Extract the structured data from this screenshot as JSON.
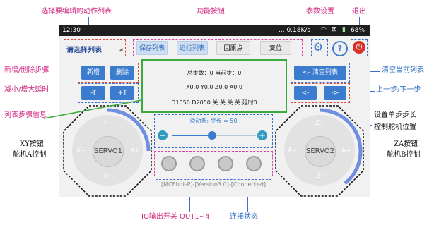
{
  "annotations": {
    "select_list": "选择要编辑的动作列表",
    "function_buttons": "功能按钮",
    "settings": "参数设置",
    "exit": "退出",
    "add_delete": "新增/删除步骤",
    "delay": "减小/增大延时",
    "step_info": "列表步骤信息",
    "xy_btn": "XY按钮",
    "servo_a": "舵机A控制",
    "clear_list": "清空当前列表",
    "prev_next": "上一步/下一步",
    "single_step": "设置单步步长",
    "servo_pos": "控制舵机位置",
    "za_btn": "ZA按钮",
    "servo_b": "舵机B控制",
    "io_output": "IO输出开关 OUT1~4",
    "conn_state": "连接状态"
  },
  "statusbar": {
    "time": "12:30",
    "speed": "... 0.18K/s",
    "battery": "68%"
  },
  "toolbar": {
    "list_select": "请选择列表",
    "save_list": "保存列表",
    "run_list": "运行列表",
    "home": "回原点",
    "reset": "复位"
  },
  "left_buttons": {
    "add": "新增",
    "delete": "删除",
    "minus_t": "-T",
    "plus_t": "+T"
  },
  "right_buttons": {
    "clear": "<- 清空列表",
    "prev": "<-",
    "next": "->"
  },
  "info": {
    "steps": "总步数：0 当前步：0",
    "coords": "X0.0 Y0.0 Z0.0 A0.0",
    "state": "D1050 D2050 关 关 关 关 延时0"
  },
  "slider": {
    "label": "滑动条: 步长 = 50",
    "minus": "−",
    "plus": "+"
  },
  "joystick_left": {
    "center": "SERVO1",
    "up": "Y+",
    "down": "Y−",
    "left": "X−",
    "right": "X+"
  },
  "joystick_right": {
    "center": "SERVO2",
    "up": "Z+",
    "down": "Z−",
    "left": "A−",
    "right": "A+"
  },
  "connection": "[MCEbot-P]-[Version3.0]-[Connected]",
  "colors": {
    "accent": "#3c7ccf",
    "annotation": "#d0237d",
    "frame": "#3bab3b"
  }
}
